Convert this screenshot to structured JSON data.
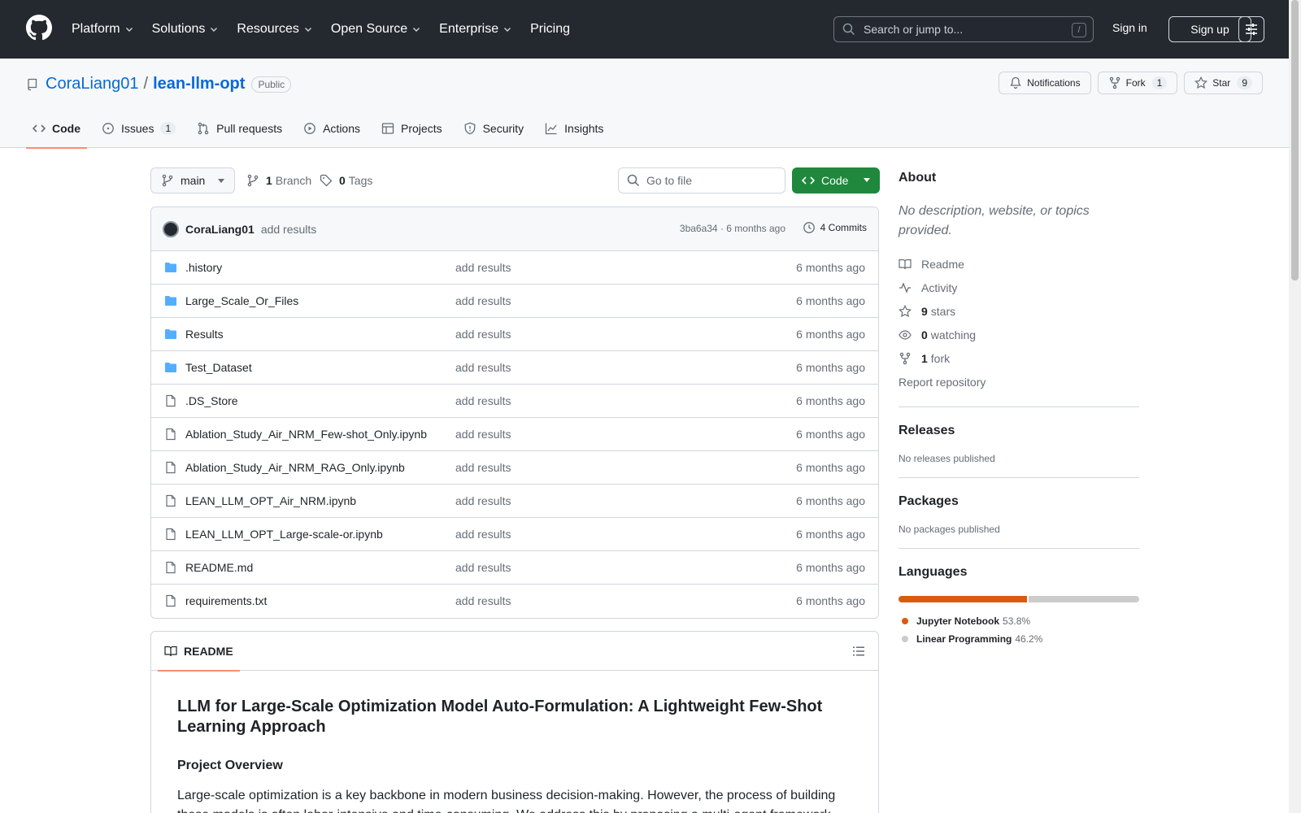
{
  "header": {
    "nav": [
      {
        "label": "Platform",
        "dropdown": true
      },
      {
        "label": "Solutions",
        "dropdown": true
      },
      {
        "label": "Resources",
        "dropdown": true
      },
      {
        "label": "Open Source",
        "dropdown": true
      },
      {
        "label": "Enterprise",
        "dropdown": true
      },
      {
        "label": "Pricing",
        "dropdown": false
      }
    ],
    "search_placeholder": "Search or jump to...",
    "search_shortcut": "/",
    "signin": "Sign in",
    "signup": "Sign up"
  },
  "repo": {
    "owner": "CoraLiang01",
    "separator": "/",
    "name": "lean-llm-opt",
    "visibility": "Public",
    "notifications": "Notifications",
    "fork_label": "Fork",
    "fork_count": "1",
    "star_label": "Star",
    "star_count": "9",
    "tabs": [
      {
        "label": "Code",
        "icon": "code-icon",
        "count": "",
        "active": true
      },
      {
        "label": "Issues",
        "icon": "issue-icon",
        "count": "1",
        "active": false
      },
      {
        "label": "Pull requests",
        "icon": "pull-request-icon",
        "count": "",
        "active": false
      },
      {
        "label": "Actions",
        "icon": "play-icon",
        "count": "",
        "active": false
      },
      {
        "label": "Projects",
        "icon": "table-icon",
        "count": "",
        "active": false
      },
      {
        "label": "Security",
        "icon": "shield-icon",
        "count": "",
        "active": false
      },
      {
        "label": "Insights",
        "icon": "graph-icon",
        "count": "",
        "active": false
      }
    ]
  },
  "filenav": {
    "branch": "main",
    "branch_count": "1",
    "branch_label": "Branch",
    "tag_count": "0",
    "tag_label": "Tags",
    "goto_placeholder": "Go to file",
    "code_button": "Code"
  },
  "commit": {
    "author": "CoraLiang01",
    "message": "add results",
    "meta": "3ba6a34 · 6 months ago",
    "commits": "4 Commits"
  },
  "files": [
    {
      "name": ".history",
      "type": "folder",
      "message": "add results",
      "time": "6 months ago"
    },
    {
      "name": "Large_Scale_Or_Files",
      "type": "folder",
      "message": "add results",
      "time": "6 months ago"
    },
    {
      "name": "Results",
      "type": "folder",
      "message": "add results",
      "time": "6 months ago"
    },
    {
      "name": "Test_Dataset",
      "type": "folder",
      "message": "add results",
      "time": "6 months ago"
    },
    {
      "name": ".DS_Store",
      "type": "file",
      "message": "add results",
      "time": "6 months ago"
    },
    {
      "name": "Ablation_Study_Air_NRM_Few-shot_Only.ipynb",
      "type": "file",
      "message": "add results",
      "time": "6 months ago"
    },
    {
      "name": "Ablation_Study_Air_NRM_RAG_Only.ipynb",
      "type": "file",
      "message": "add results",
      "time": "6 months ago"
    },
    {
      "name": "LEAN_LLM_OPT_Air_NRM.ipynb",
      "type": "file",
      "message": "add results",
      "time": "6 months ago"
    },
    {
      "name": "LEAN_LLM_OPT_Large-scale-or.ipynb",
      "type": "file",
      "message": "add results",
      "time": "6 months ago"
    },
    {
      "name": "README.md",
      "type": "file",
      "message": "add results",
      "time": "6 months ago"
    },
    {
      "name": "requirements.txt",
      "type": "file",
      "message": "add results",
      "time": "6 months ago"
    }
  ],
  "readme": {
    "tab": "README",
    "h1": "LLM for Large-Scale Optimization Model Auto-Formulation: A Lightweight Few-Shot Learning Approach",
    "h2": "Project Overview",
    "p": "Large-scale optimization is a key backbone in modern business decision-making. However, the process of building these models is often labor-intensive and time-consuming. We address this by proposing a multi-agent framework"
  },
  "sidebar": {
    "about_title": "About",
    "description": "No description, website, or topics provided.",
    "readme": "Readme",
    "activity": "Activity",
    "stars_count": "9",
    "stars_label": "stars",
    "watching_count": "0",
    "watching_label": "watching",
    "fork_count": "1",
    "fork_label": "fork",
    "report": "Report repository",
    "releases_title": "Releases",
    "releases_none": "No releases published",
    "packages_title": "Packages",
    "packages_none": "No packages published",
    "languages_title": "Languages",
    "languages": [
      {
        "name": "Jupyter Notebook",
        "percent": "53.8%",
        "value": 53.8,
        "color": "#DA5B0B"
      },
      {
        "name": "Linear Programming",
        "percent": "46.2%",
        "value": 46.2,
        "color": "#CCCCCC"
      }
    ]
  },
  "colors": {
    "header_bg": "#24292f",
    "link": "#0969da",
    "primary_button": "#1f883d",
    "active_tab_underline": "#fd8c73",
    "folder": "#54aeff"
  }
}
